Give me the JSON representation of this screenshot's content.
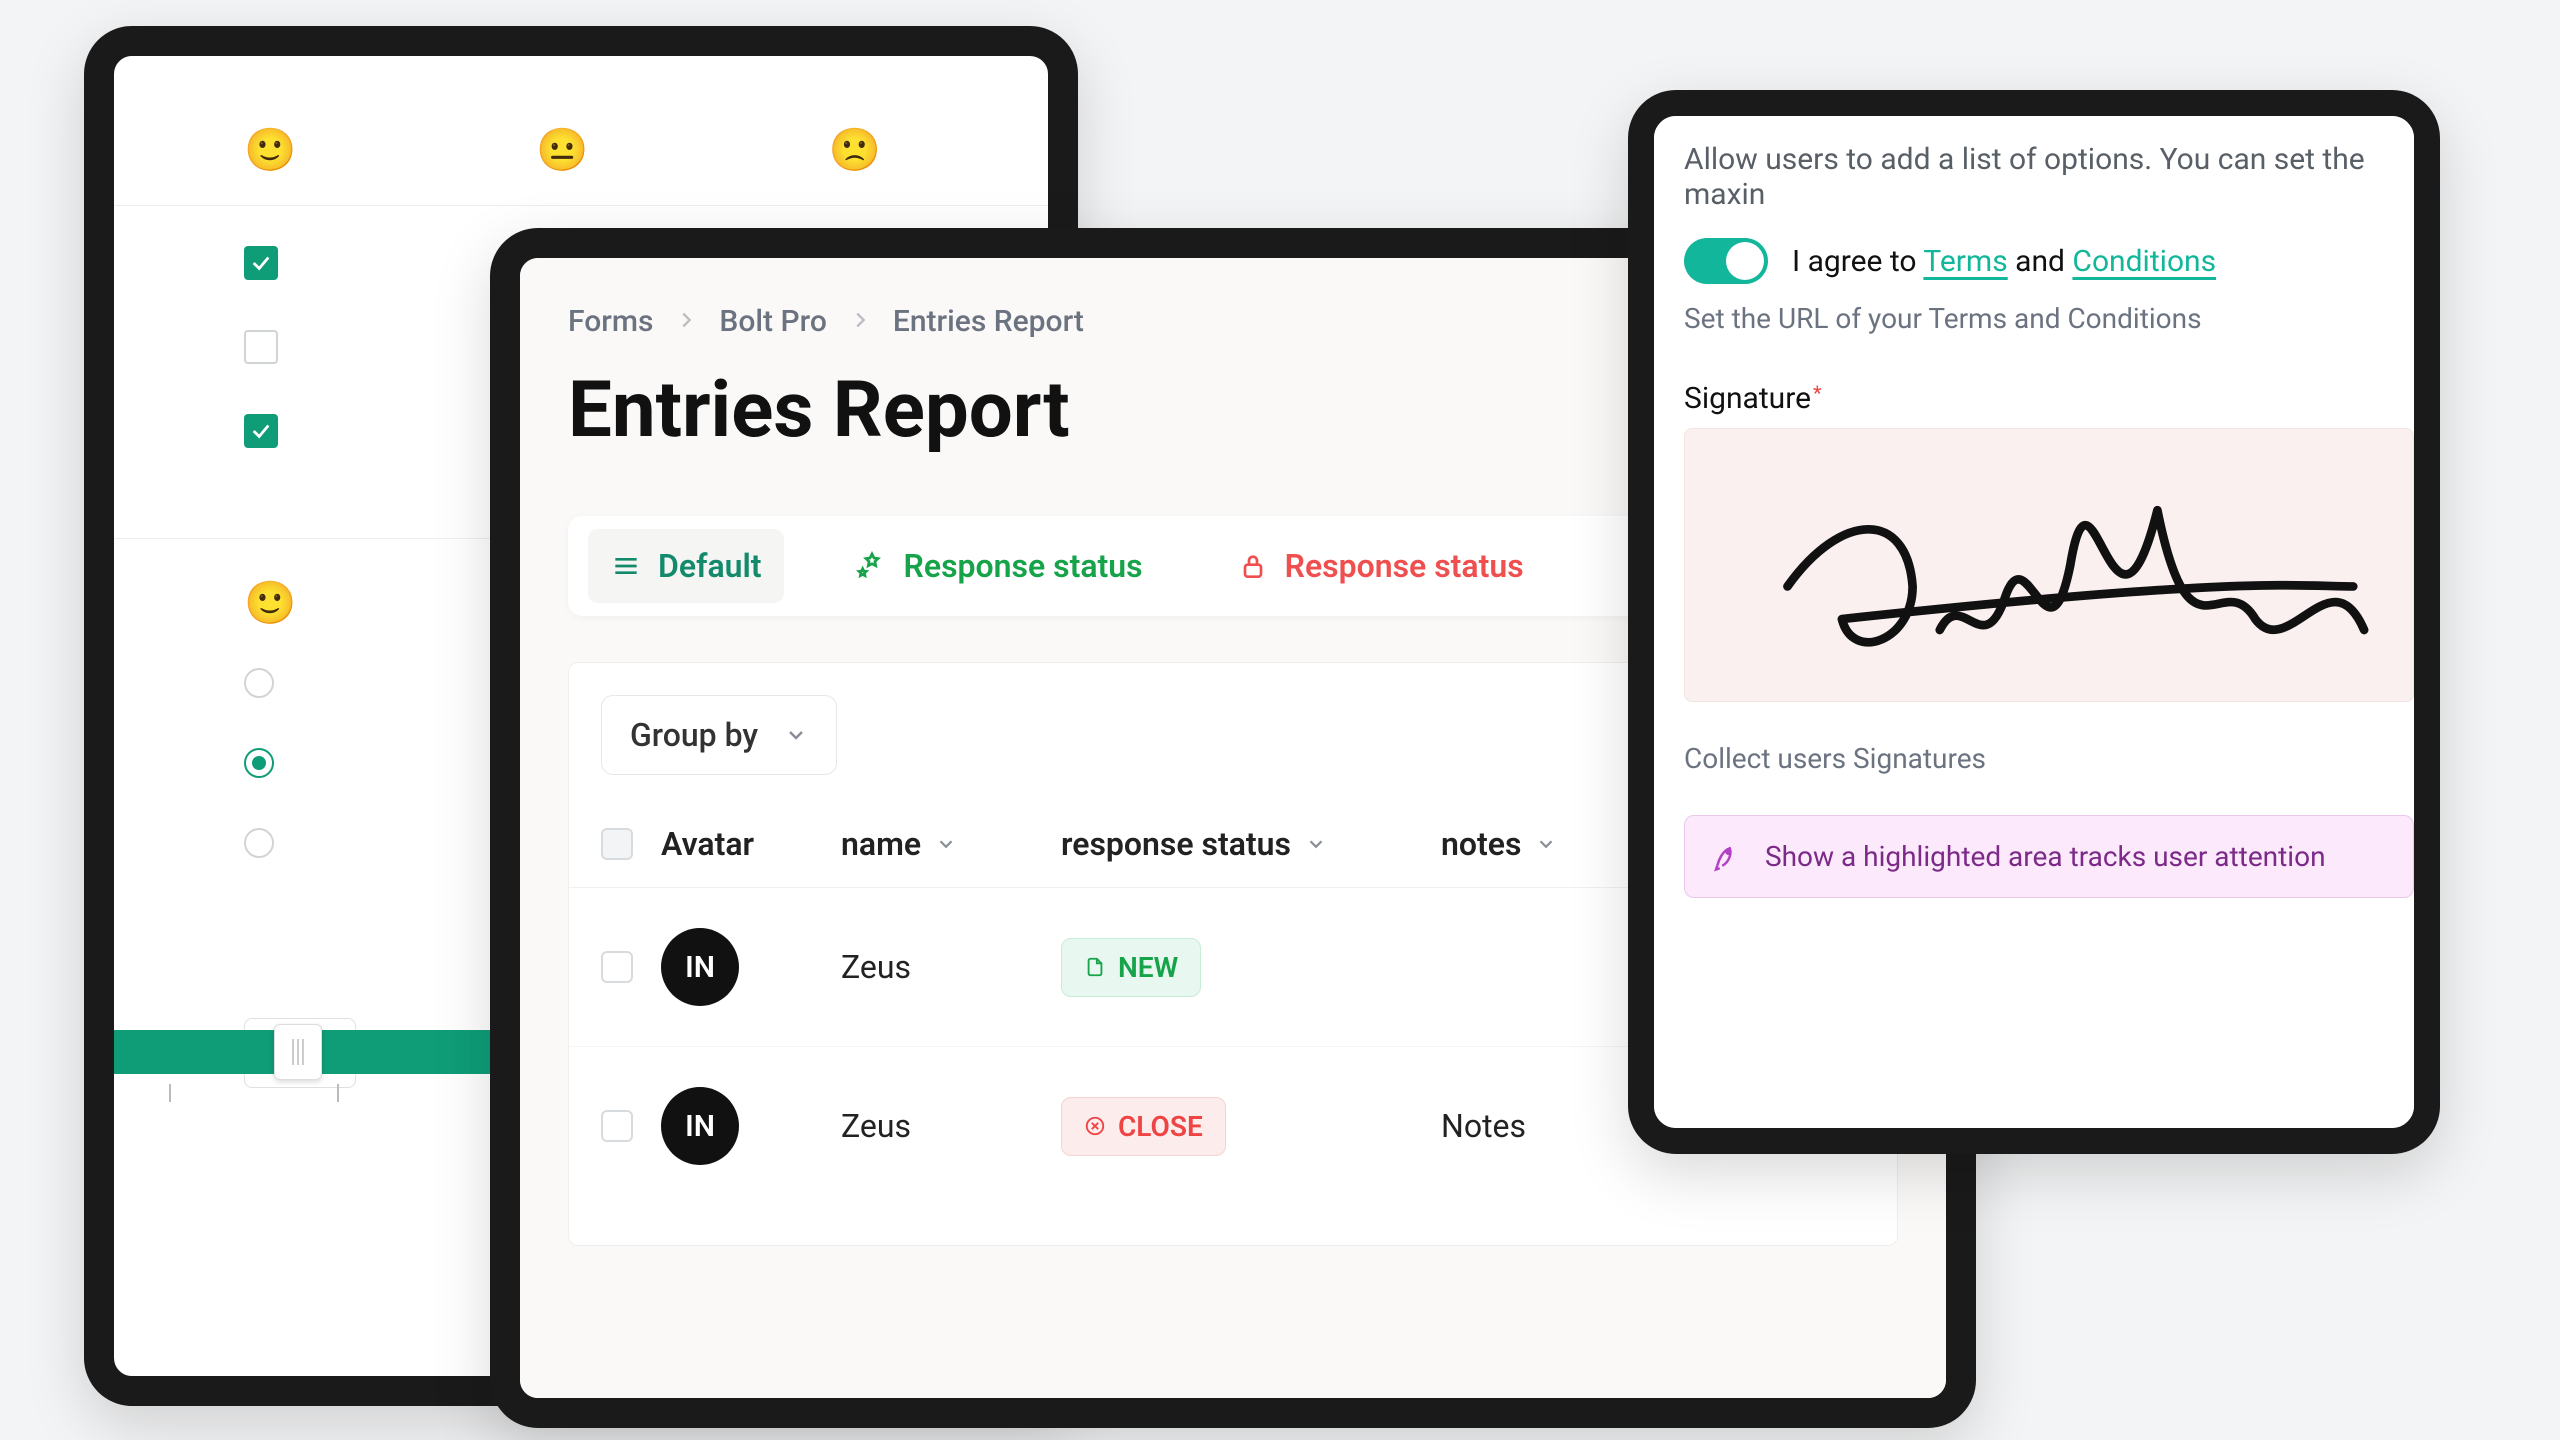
{
  "leftPanel": {
    "emojis": [
      "🙂",
      "😐",
      "🙁"
    ],
    "checks": [
      true,
      false,
      true
    ],
    "radioEmoji": "🙂",
    "radios": [
      false,
      true,
      false
    ],
    "sliderValue": "6.00"
  },
  "centerPanel": {
    "breadcrumb": [
      "Forms",
      "Bolt Pro",
      "Entries Report"
    ],
    "title": "Entries Report",
    "tabs": {
      "default": "Default",
      "respGreen": "Response status",
      "respRed": "Response status"
    },
    "groupBy": "Group by",
    "columns": {
      "avatar": "Avatar",
      "name": "name",
      "resp": "response status",
      "notes": "notes"
    },
    "rows": [
      {
        "avatar": "IN",
        "name": "Zeus",
        "status": "NEW",
        "statusKind": "new",
        "notes": ""
      },
      {
        "avatar": "IN",
        "name": "Zeus",
        "status": "CLOSE",
        "statusKind": "close",
        "notes": "Notes"
      }
    ]
  },
  "rightPanel": {
    "topDesc": "Allow users to add a list of options. You can set the maxin",
    "agreePrefix": "I agree to ",
    "termsWord": "Terms",
    "andWord": " and ",
    "condWord": "Conditions",
    "urlNote": "Set the URL of your Terms and Conditions",
    "sigLabel": "Signature",
    "sigReq": "*",
    "sigDesc": "Collect users Signatures",
    "hlText": "Show a highlighted area tracks user attention"
  }
}
